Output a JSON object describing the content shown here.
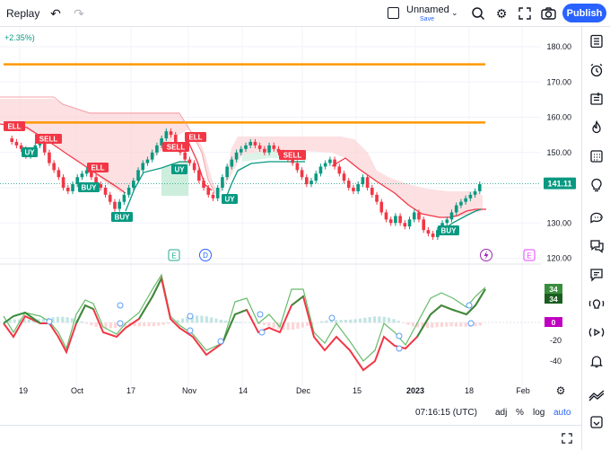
{
  "toolbar": {
    "replay_label": "Replay",
    "chart_name": "Unnamed",
    "save_label": "Save",
    "publish_label": "Publish",
    "icons": [
      "undo-icon",
      "redo-icon",
      "layout-icon",
      "chevron-down-icon",
      "search-icon",
      "gear-icon",
      "fullscreen-icon",
      "camera-icon"
    ]
  },
  "legend": {
    "change_text": "+2.35%)"
  },
  "price_axis": {
    "ticks": [
      "180.00",
      "170.00",
      "160.00",
      "150.00",
      "130.00",
      "120.00"
    ],
    "current_price": "141.11",
    "current_price_color": "#089981"
  },
  "indicator_axis": {
    "ticks": [
      "-20",
      "-40"
    ],
    "badge_top": "34",
    "badge_bottom": "34",
    "badge_zero": "0"
  },
  "time_axis": {
    "labels": [
      "19",
      "Oct",
      "17",
      "Nov",
      "14",
      "Dec",
      "15",
      "2023",
      "18",
      "Feb"
    ]
  },
  "signals": {
    "buy_label": "BUY",
    "sell_label": "SELL",
    "partial_buy": "UY",
    "partial_sell_a": "ELL",
    "partial_sell_b": "ELL",
    "partial_sell_c": "ELL",
    "partial_ell": "ELL"
  },
  "events": {
    "earnings_label": "E",
    "dividend_label": "D",
    "split_icon": "lightning-icon"
  },
  "status": {
    "time": "07:16:15 (UTC)",
    "adj": "adj",
    "percent": "%",
    "log": "log",
    "auto": "auto"
  },
  "colors": {
    "up": "#089981",
    "down": "#f23645",
    "hline": "#ff9800",
    "cloud": "#fbd5d8",
    "cloud_green": "#c8ecd9",
    "macd_green": "#388e3c",
    "accent": "#2962ff"
  }
}
